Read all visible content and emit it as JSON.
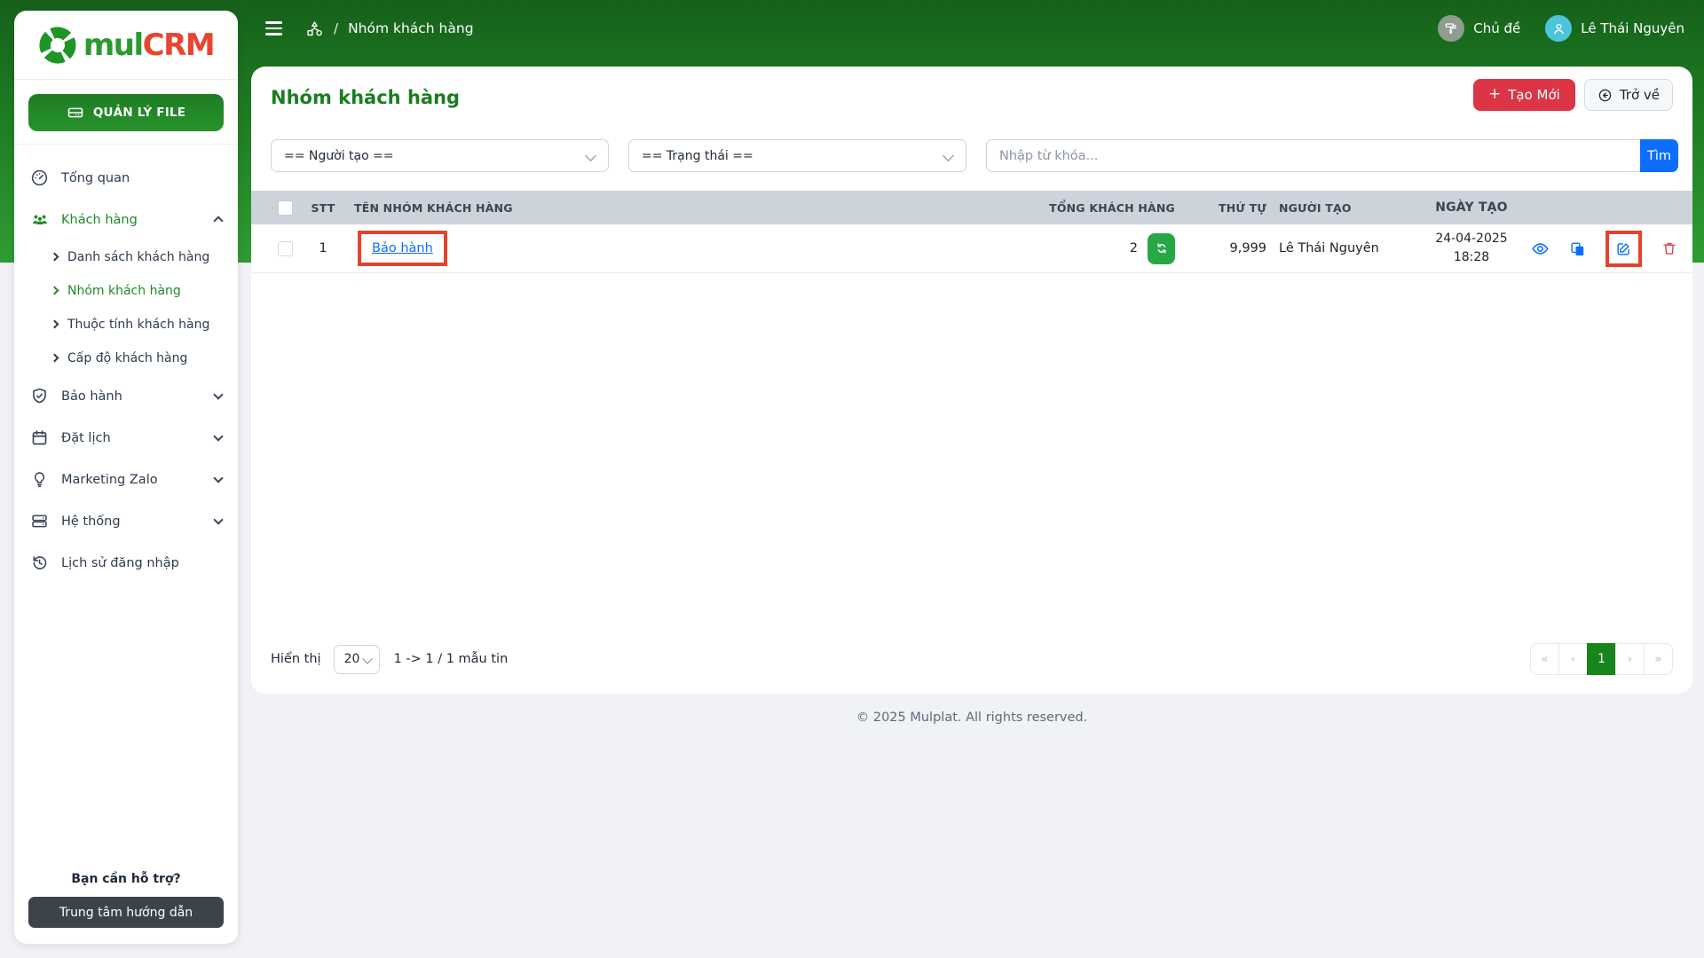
{
  "brand": {
    "name_part1": "mul",
    "name_part2": "CRM"
  },
  "topbar": {
    "breadcrumb_separator": "/",
    "breadcrumb": "Nhóm khách hàng",
    "theme_label": "Chủ đề",
    "user_name": "Lê Thái Nguyên"
  },
  "sidebar": {
    "file_button": "QUẢN LÝ FILE",
    "items": [
      {
        "label": "Tổng quan"
      },
      {
        "label": "Khách hàng",
        "children": [
          "Danh sách khách hàng",
          "Nhóm khách hàng",
          "Thuộc tính khách hàng",
          "Cấp độ khách hàng"
        ]
      },
      {
        "label": "Bảo hành"
      },
      {
        "label": "Đặt lịch"
      },
      {
        "label": "Marketing Zalo"
      },
      {
        "label": "Hệ thống"
      },
      {
        "label": "Lịch sử đăng nhập"
      }
    ],
    "help_text": "Bạn cần hỗ trợ?",
    "help_button": "Trung tâm hướng dẫn"
  },
  "page": {
    "title": "Nhóm khách hàng",
    "create_plus": "+",
    "create_button": "Tạo Mới",
    "back_button": "Trở về",
    "filters": {
      "creator_select": "== Người tạo ==",
      "status_select": "== Trạng thái ==",
      "search_placeholder": "Nhập từ khóa...",
      "search_button": "Tìm"
    },
    "table": {
      "headers": [
        "STT",
        "TÊN NHÓM KHÁCH HÀNG",
        "TỔNG KHÁCH HÀNG",
        "THỨ TỰ",
        "NGƯỜI TẠO",
        "NGÀY TẠO"
      ],
      "rows": [
        {
          "stt": "1",
          "name": "Bảo hành",
          "total": "2",
          "order": "9,999",
          "creator": "Lê Thái Nguyên",
          "date": "24-04-2025",
          "time": "18:28"
        }
      ]
    },
    "pagination": {
      "show_label": "Hiển thị",
      "page_size": "20",
      "range_text": "1 -> 1 / 1 mẫu tin",
      "pages": [
        "«",
        "‹",
        "1",
        "›",
        "»"
      ],
      "active_page": "1"
    }
  },
  "footer": {
    "copyright": "© 2025 Mulplat. All rights reserved."
  },
  "colors": {
    "brand_green": "#1f8b26",
    "brand_red": "#e8442e",
    "topbar_green": "#1e7d22",
    "accent_blue": "#0d6efd",
    "danger_red": "#dc3545",
    "success_green": "#28a745",
    "annotation_red": "#e3432c",
    "table_header_bg": "#ccd3da",
    "pagination_active": "#17851b"
  },
  "icons": {
    "hamburger-icon": "three bars",
    "sitemap-icon": "hierarchy triangle/square/circle",
    "paint-roller-icon": "theme roller in circle",
    "user-avatar-icon": "person in teal circle",
    "harddrive-icon": "drive on file button",
    "gauge-icon": "speedometer",
    "users-icon": "people group",
    "shield-check-icon": "shield with check",
    "calendar-icon": "calendar",
    "lightbulb-icon": "light bulb",
    "server-icon": "stacked servers",
    "history-icon": "clock with back arrow",
    "eye-icon": "view",
    "copy-icon": "duplicate",
    "edit-icon": "pencil square",
    "trash-icon": "delete",
    "refresh-icon": "sync arrows",
    "back-circle-icon": "arrow left in circle"
  }
}
